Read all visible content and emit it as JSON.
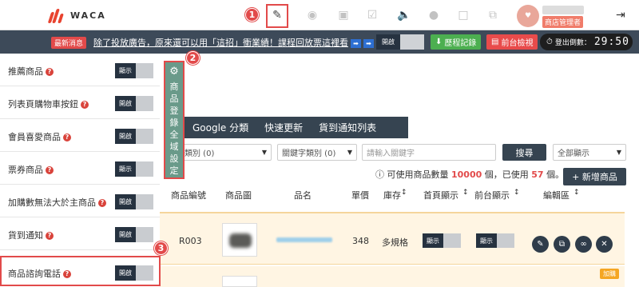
{
  "app": {
    "logo_text": "WACA"
  },
  "header": {
    "nav_icons": [
      "edit-icon",
      "palette-icon",
      "store-icon",
      "clipboard-check-icon",
      "megaphone-icon",
      "user-icon",
      "document-icon",
      "copy-add-icon"
    ],
    "user_role": "商店管理者",
    "logout_icon": "logout-icon"
  },
  "steps": [
    "1",
    "2",
    "3"
  ],
  "news": {
    "tag": "最新消息",
    "text": "除了投放廣告，原來還可以用「這招」衝業績！課程回放票這裡看",
    "arrows": [
      "➡",
      "➡"
    ],
    "toggle_label": "開啟"
  },
  "toolbar": {
    "history_label": "歷程記錄",
    "front_label": "前台檢視",
    "logout_label": "登出倒數：",
    "logout_time": "29:50"
  },
  "settings": {
    "rows": [
      {
        "label": "推薦商品",
        "state": "顯示"
      },
      {
        "label": "列表頁購物車按鈕",
        "state": "開啟"
      },
      {
        "label": "會員喜愛商品",
        "state": "開啟"
      },
      {
        "label": "票券商品",
        "state": "顯示"
      },
      {
        "label": "加購數無法大於主商品",
        "state": "開啟"
      },
      {
        "label": "貨到通知",
        "state": "開啟"
      },
      {
        "label": "商品諮詢電話",
        "state": "開啟"
      }
    ]
  },
  "global_tab": {
    "label": "商品登錄全域設定"
  },
  "tabs": [
    "Google 分類",
    "快速更新",
    "貨到通知列表"
  ],
  "filters": {
    "category": "類別 (0)",
    "keyword_category": "關鍵字類別 (0)",
    "keyword_placeholder": "請輸入關鍵字",
    "search_label": "搜尋",
    "display_filter": "全部顯示"
  },
  "info": {
    "prefix": "可使用商品數量",
    "total": "10000",
    "mid": "個，已使用",
    "used": "57",
    "suffix": "個。"
  },
  "add_product_label": "+ 新增商品",
  "table": {
    "headers": [
      "商品編號",
      "商品圖",
      "品名",
      "單價",
      "庫存",
      "首頁顯示",
      "前台顯示",
      "編輯區"
    ],
    "rows": [
      {
        "code": "R003",
        "price": "348",
        "stock": "多規格",
        "home_display": "顯示",
        "front_display": "顯示"
      }
    ],
    "addon_tag": "加購"
  }
}
